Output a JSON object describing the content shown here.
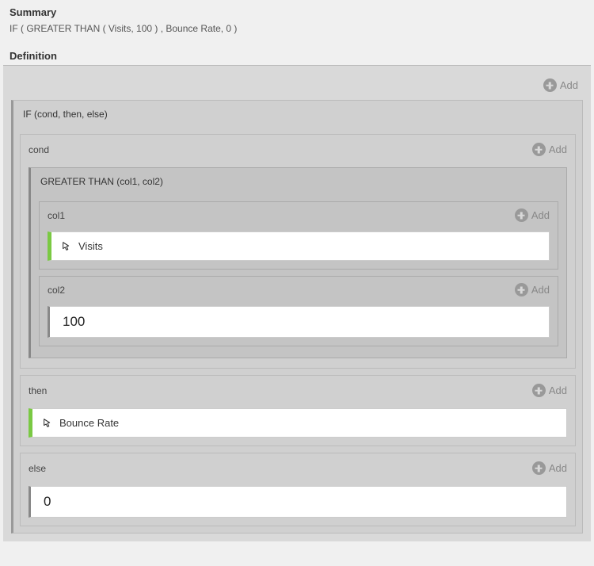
{
  "summary": {
    "title": "Summary",
    "expression": "IF ( GREATER THAN ( Visits, 100 ) , Bounce Rate, 0 )"
  },
  "definition": {
    "title": "Definition",
    "add_label": "Add"
  },
  "if_block": {
    "header": "IF (cond, then, else)",
    "cond": {
      "label": "cond",
      "add": "Add",
      "gt": {
        "header": "GREATER THAN (col1, col2)",
        "col1": {
          "label": "col1",
          "add": "Add",
          "value": "Visits"
        },
        "col2": {
          "label": "col2",
          "add": "Add",
          "value": "100"
        }
      }
    },
    "then": {
      "label": "then",
      "add": "Add",
      "value": "Bounce Rate"
    },
    "else": {
      "label": "else",
      "add": "Add",
      "value": "0"
    }
  }
}
